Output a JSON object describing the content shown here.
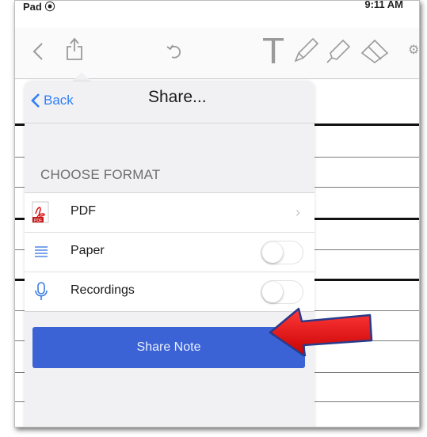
{
  "status_bar": {
    "device": "Pad",
    "time": "9:11 AM"
  },
  "toolbar": {
    "icons": [
      "back-icon",
      "share-icon",
      "undo-icon",
      "text-tool-icon",
      "pen-icon",
      "highlighter-icon",
      "eraser-icon"
    ]
  },
  "share_popover": {
    "back_label": "Back",
    "title": "Share...",
    "section_label": "CHOOSE FORMAT",
    "options": [
      {
        "label": "PDF",
        "icon": "pdf-icon",
        "accessory": "chevron"
      },
      {
        "label": "Paper",
        "icon": "paper-icon",
        "accessory": "toggle",
        "on": false
      },
      {
        "label": "Recordings",
        "icon": "microphone-icon",
        "accessory": "toggle",
        "on": false
      }
    ],
    "share_button_label": "Share Note"
  },
  "annotation": {
    "arrow_color": "#e01010",
    "points_to": "Share Note"
  },
  "colors": {
    "accent": "#2f7ff7",
    "share_button": "#3b63d6"
  }
}
